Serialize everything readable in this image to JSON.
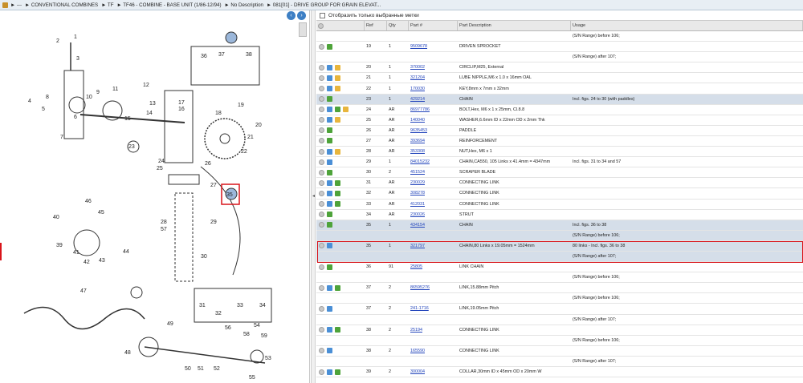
{
  "breadcrumb": [
    "---",
    "CONVENTIONAL COMBINES",
    "TF",
    "TF46 - COMBINE - BASE UNIT (1/86-12/94)",
    "No Description",
    "081[01] - DRIVE GROUP FOR GRAIN ELEVAT..."
  ],
  "filter_label": "Отобразить только выбранные метки",
  "columns": [
    "",
    "Ref",
    "Qty",
    "Part #",
    "Part Description",
    "Usage"
  ],
  "rows": [
    {
      "ref": "",
      "qty": "",
      "part": "",
      "desc": "",
      "usage": "(S/N Range) before 106;",
      "icons": [],
      "hl": false
    },
    {
      "ref": "19",
      "qty": "1",
      "part": "9509678",
      "desc": "DRIVEN SPROCKET",
      "usage": "",
      "icons": [
        "o",
        "g"
      ],
      "hl": false
    },
    {
      "ref": "",
      "qty": "",
      "part": "",
      "desc": "",
      "usage": "(S/N Range) after 107;",
      "icons": [],
      "hl": false
    },
    {
      "ref": "20",
      "qty": "1",
      "part": "370002",
      "desc": "CIRCLIP,M25, External",
      "usage": "",
      "icons": [
        "o",
        "b",
        "y"
      ],
      "hl": false
    },
    {
      "ref": "21",
      "qty": "1",
      "part": "321204",
      "desc": "LUBE NIPPLE,M6 x 1.0 x 16mm OAL",
      "usage": "",
      "icons": [
        "o",
        "b",
        "y"
      ],
      "hl": false
    },
    {
      "ref": "22",
      "qty": "1",
      "part": "170030",
      "desc": "KEY,8mm x 7mm x 32mm",
      "usage": "",
      "icons": [
        "o",
        "b",
        "y"
      ],
      "hl": false
    },
    {
      "ref": "23",
      "qty": "1",
      "part": "429214",
      "desc": "CHAIN",
      "usage": "Incl. figs. 24 to 30 (with paddles)",
      "icons": [
        "o",
        "g"
      ],
      "hl": true
    },
    {
      "ref": "24",
      "qty": "AR",
      "part": "86977786",
      "desc": "BOLT,Hex, M6 x 1 x 25mm, Cl.8.8",
      "usage": "",
      "icons": [
        "o",
        "b",
        "g",
        "y"
      ],
      "hl": false
    },
    {
      "ref": "25",
      "qty": "AR",
      "part": "140040",
      "desc": "WASHER,6.6mm ID x 22mm OD x 2mm Thk",
      "usage": "",
      "icons": [
        "o",
        "b",
        "y"
      ],
      "hl": false
    },
    {
      "ref": "26",
      "qty": "AR",
      "part": "9635453",
      "desc": "PADDLE",
      "usage": "",
      "icons": [
        "o",
        "g"
      ],
      "hl": false
    },
    {
      "ref": "27",
      "qty": "AR",
      "part": "393694",
      "desc": "REINFORCEMENT",
      "usage": "",
      "icons": [
        "o",
        "g"
      ],
      "hl": false
    },
    {
      "ref": "28",
      "qty": "AR",
      "part": "353308",
      "desc": "NUT,Hex, M6 x 1",
      "usage": "",
      "icons": [
        "o",
        "b",
        "y"
      ],
      "hl": false
    },
    {
      "ref": "29",
      "qty": "1",
      "part": "84015232",
      "desc": "CHAIN,CA550, 105 Links x 41.4mm = 4347mm",
      "usage": "Incl. figs. 31 to 34 and 57",
      "icons": [
        "o",
        "b"
      ],
      "hl": false
    },
    {
      "ref": "30",
      "qty": "2",
      "part": "451524",
      "desc": "SCRAPER BLADE",
      "usage": "",
      "icons": [
        "o",
        "g"
      ],
      "hl": false
    },
    {
      "ref": "31",
      "qty": "AR",
      "part": "230029",
      "desc": "CONNECTING LINK",
      "usage": "",
      "icons": [
        "o",
        "b",
        "g"
      ],
      "hl": false
    },
    {
      "ref": "32",
      "qty": "AR",
      "part": "308278",
      "desc": "CONNECTING LINK",
      "usage": "",
      "icons": [
        "o",
        "b",
        "g"
      ],
      "hl": false
    },
    {
      "ref": "33",
      "qty": "AR",
      "part": "412031",
      "desc": "CONNECTING LINK",
      "usage": "",
      "icons": [
        "o",
        "b",
        "g"
      ],
      "hl": false
    },
    {
      "ref": "34",
      "qty": "AR",
      "part": "230026",
      "desc": "STRUT",
      "usage": "",
      "icons": [
        "o",
        "g"
      ],
      "hl": false
    },
    {
      "ref": "35",
      "qty": "1",
      "part": "434154",
      "desc": "CHAIN",
      "usage": "Incl. figs. 36 to 38",
      "icons": [
        "o",
        "g"
      ],
      "hl": true
    },
    {
      "ref": "",
      "qty": "",
      "part": "",
      "desc": "",
      "usage": "(S/N Range) before 106;",
      "icons": [],
      "hl": true
    },
    {
      "ref": "35",
      "qty": "1",
      "part": "321797",
      "desc": "CHAIN,80 Links x 19.05mm = 1524mm",
      "usage": "80 links - Incl. figs. 36 to 38",
      "icons": [
        "o",
        "b"
      ],
      "hl": true
    },
    {
      "ref": "",
      "qty": "",
      "part": "",
      "desc": "",
      "usage": "(S/N Range) after 107;",
      "icons": [],
      "hl": true
    },
    {
      "ref": "36",
      "qty": "91",
      "part": "25805",
      "desc": "LINK CHAIN",
      "usage": "",
      "icons": [
        "o",
        "g"
      ],
      "hl": false
    },
    {
      "ref": "",
      "qty": "",
      "part": "",
      "desc": "",
      "usage": "(S/N Range) before 106;",
      "icons": [],
      "hl": false
    },
    {
      "ref": "37",
      "qty": "2",
      "part": "86595276",
      "desc": "LINK,15.88mm Pitch",
      "usage": "",
      "icons": [
        "o",
        "b",
        "g"
      ],
      "hl": false
    },
    {
      "ref": "",
      "qty": "",
      "part": "",
      "desc": "",
      "usage": "(S/N Range) before 106;",
      "icons": [],
      "hl": false
    },
    {
      "ref": "37",
      "qty": "2",
      "part": "241-1716",
      "desc": "LINK,19.05mm Pitch",
      "usage": "",
      "icons": [
        "o",
        "b"
      ],
      "hl": false
    },
    {
      "ref": "",
      "qty": "",
      "part": "",
      "desc": "",
      "usage": "(S/N Range) after 107;",
      "icons": [],
      "hl": false
    },
    {
      "ref": "38",
      "qty": "2",
      "part": "25194",
      "desc": "CONNECTING LINK",
      "usage": "",
      "icons": [
        "o",
        "b",
        "g"
      ],
      "hl": false
    },
    {
      "ref": "",
      "qty": "",
      "part": "",
      "desc": "",
      "usage": "(S/N Range) before 106;",
      "icons": [],
      "hl": false
    },
    {
      "ref": "38",
      "qty": "2",
      "part": "165590",
      "desc": "CONNECTING LINK",
      "usage": "",
      "icons": [
        "o",
        "b"
      ],
      "hl": false
    },
    {
      "ref": "",
      "qty": "",
      "part": "",
      "desc": "",
      "usage": "(S/N Range) after 107;",
      "icons": [],
      "hl": false
    },
    {
      "ref": "39",
      "qty": "2",
      "part": "300004",
      "desc": "COLLAR,30mm ID x 45mm OD x 20mm W",
      "usage": "",
      "icons": [
        "o",
        "b",
        "g"
      ],
      "hl": false
    }
  ],
  "callouts": [
    "1",
    "2",
    "3",
    "4",
    "5",
    "6",
    "7",
    "8",
    "9",
    "10",
    "11",
    "12",
    "13",
    "14",
    "15",
    "16",
    "17",
    "18",
    "19",
    "20",
    "21",
    "22",
    "23",
    "24",
    "25",
    "26",
    "27",
    "28",
    "29",
    "30",
    "31",
    "32",
    "33",
    "34",
    "35",
    "36",
    "37",
    "38",
    "39",
    "40",
    "41",
    "42",
    "43",
    "44",
    "45",
    "46",
    "47",
    "48",
    "49",
    "50",
    "51",
    "52",
    "53",
    "54",
    "55",
    "56",
    "57",
    "58",
    "59"
  ]
}
